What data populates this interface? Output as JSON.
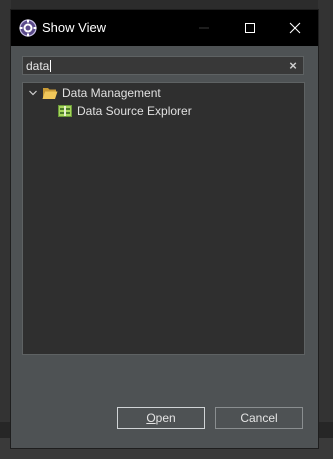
{
  "window": {
    "title": "Show View",
    "controls": {
      "minimize": "minimize",
      "maximize": "maximize",
      "close": "close"
    }
  },
  "search": {
    "value": "data",
    "clear_icon": "×"
  },
  "tree": {
    "groups": [
      {
        "label": "Data Management",
        "expanded": true,
        "icon": "folder-open-icon",
        "children": [
          {
            "label": "Data Source Explorer",
            "icon": "data-source-explorer-icon"
          }
        ]
      }
    ]
  },
  "buttons": {
    "open": {
      "mnemonic": "O",
      "rest": "pen"
    },
    "cancel": {
      "label": "Cancel"
    }
  },
  "colors": {
    "titlebar": "#000000",
    "dialog_bg": "#4e5254",
    "tree_bg": "#2f2f2f",
    "folder": "#e8b64a",
    "view_icon": "#8bc34a"
  }
}
